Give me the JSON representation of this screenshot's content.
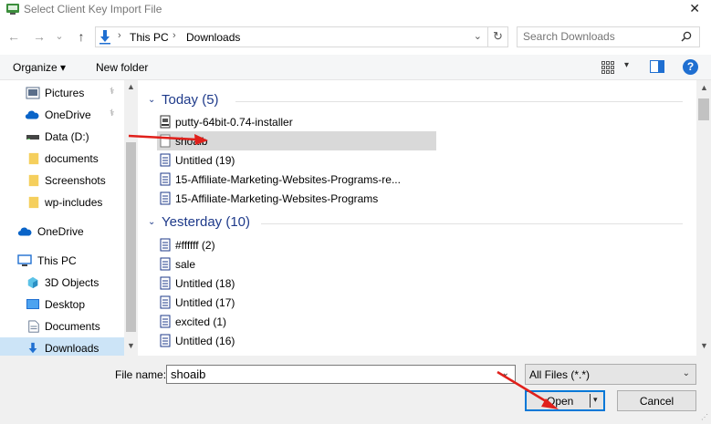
{
  "window": {
    "title": "Select Client Key Import File",
    "close_glyph": "✕"
  },
  "address": {
    "back_glyph": "←",
    "forward_glyph": "→",
    "dropdown_glyph": "⌄",
    "up_glyph": "↑",
    "crumbs": [
      "This PC",
      "Downloads"
    ],
    "sep_glyph": "›",
    "refresh_glyph": "↻"
  },
  "search": {
    "placeholder": "Search Downloads",
    "icon": "search-icon"
  },
  "toolbar": {
    "organize_label": "Organize ▾",
    "new_folder_label": "New folder",
    "view_dd_glyph": "▾",
    "help_glyph": "?"
  },
  "nav": {
    "items": [
      {
        "label": "Pictures",
        "icon": "pictures-icon",
        "pinned": true
      },
      {
        "label": "OneDrive",
        "icon": "onedrive-icon",
        "pinned": true
      },
      {
        "label": "Data (D:)",
        "icon": "drive-icon",
        "pinned": false
      },
      {
        "label": "documents",
        "icon": "folder-icon",
        "pinned": false
      },
      {
        "label": "Screenshots",
        "icon": "folder-icon",
        "pinned": false
      },
      {
        "label": "wp-includes",
        "icon": "folder-icon",
        "pinned": false
      },
      {
        "label": "OneDrive",
        "icon": "onedrive-icon",
        "pinned": false
      },
      {
        "label": "This PC",
        "icon": "pc-icon",
        "pinned": false
      },
      {
        "label": "3D Objects",
        "icon": "3d-objects-icon",
        "pinned": false
      },
      {
        "label": "Desktop",
        "icon": "desktop-icon",
        "pinned": false
      },
      {
        "label": "Documents",
        "icon": "documents-icon",
        "pinned": false
      },
      {
        "label": "Downloads",
        "icon": "downloads-icon",
        "pinned": false
      }
    ],
    "pin_glyph": "📌",
    "selected": "Downloads"
  },
  "files": {
    "groups": [
      {
        "title": "Today (5)",
        "items": [
          {
            "label": "putty-64bit-0.74-installer",
            "icon": "installer-icon"
          },
          {
            "label": "shoaib",
            "icon": "file-icon",
            "selected": true
          },
          {
            "label": "Untitled (19)",
            "icon": "document-icon"
          },
          {
            "label": "15-Affiliate-Marketing-Websites-Programs-re...",
            "icon": "document-icon"
          },
          {
            "label": "15-Affiliate-Marketing-Websites-Programs",
            "icon": "document-icon"
          }
        ]
      },
      {
        "title": "Yesterday (10)",
        "items": [
          {
            "label": "#ffffff (2)",
            "icon": "document-icon"
          },
          {
            "label": "sale",
            "icon": "document-icon"
          },
          {
            "label": "Untitled (18)",
            "icon": "document-icon"
          },
          {
            "label": "Untitled (17)",
            "icon": "document-icon"
          },
          {
            "label": "excited (1)",
            "icon": "document-icon"
          },
          {
            "label": "Untitled (16)",
            "icon": "document-icon"
          }
        ]
      }
    ],
    "collapse_glyph": "⌄"
  },
  "bottom": {
    "file_name_label": "File name:",
    "file_name_value": "shoaib",
    "filter_value": "All Files (*.*)",
    "dd_glyph": "⌄",
    "open_label": "Open",
    "open_dd_glyph": "▾",
    "cancel_label": "Cancel"
  },
  "colors": {
    "accent": "#0078d7",
    "group_title": "#1e3a8a",
    "arrow": "#e0201b",
    "selected_row": "#d9d9d9",
    "selected_nav": "#cce4f7"
  }
}
